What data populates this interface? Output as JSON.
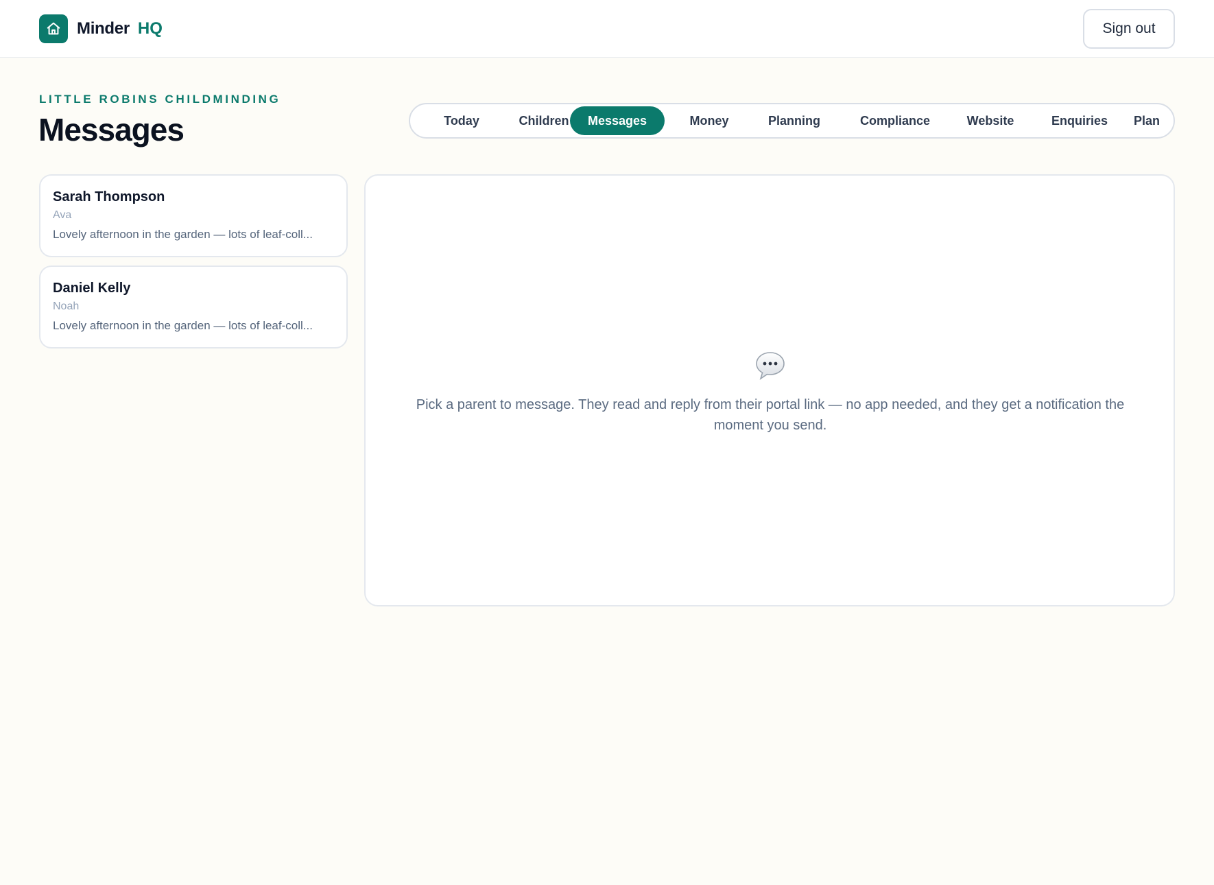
{
  "header": {
    "brand_name": "Minder",
    "brand_suffix": "HQ",
    "logo_icon": "home-icon",
    "sign_out_label": "Sign out"
  },
  "page": {
    "eyebrow": "LITTLE ROBINS CHILDMINDING",
    "title": "Messages"
  },
  "nav": {
    "active": "Messages",
    "tabs": [
      {
        "label": "Today"
      },
      {
        "label": "Children"
      },
      {
        "label": "Messages"
      },
      {
        "label": "Money"
      },
      {
        "label": "Planning"
      },
      {
        "label": "Compliance"
      },
      {
        "label": "Website"
      },
      {
        "label": "Enquiries"
      },
      {
        "label": "Plan"
      }
    ]
  },
  "threads": [
    {
      "parent": "Sarah Thompson",
      "child": "Ava",
      "preview": "Lovely afternoon in the garden — lots of leaf-coll..."
    },
    {
      "parent": "Daniel Kelly",
      "child": "Noah",
      "preview": "Lovely afternoon in the garden — lots of leaf-coll..."
    }
  ],
  "empty_state": {
    "icon": "speech-bubble-icon",
    "text": "Pick a parent to message. They read and reply from their portal link — no app needed, and they get a notification the moment you send."
  },
  "colors": {
    "accent": "#0b7a6c",
    "background": "#fdfcf7",
    "surface": "#ffffff",
    "border": "#e4e8ee",
    "heading": "#0f172a",
    "muted": "#5a6a80"
  }
}
